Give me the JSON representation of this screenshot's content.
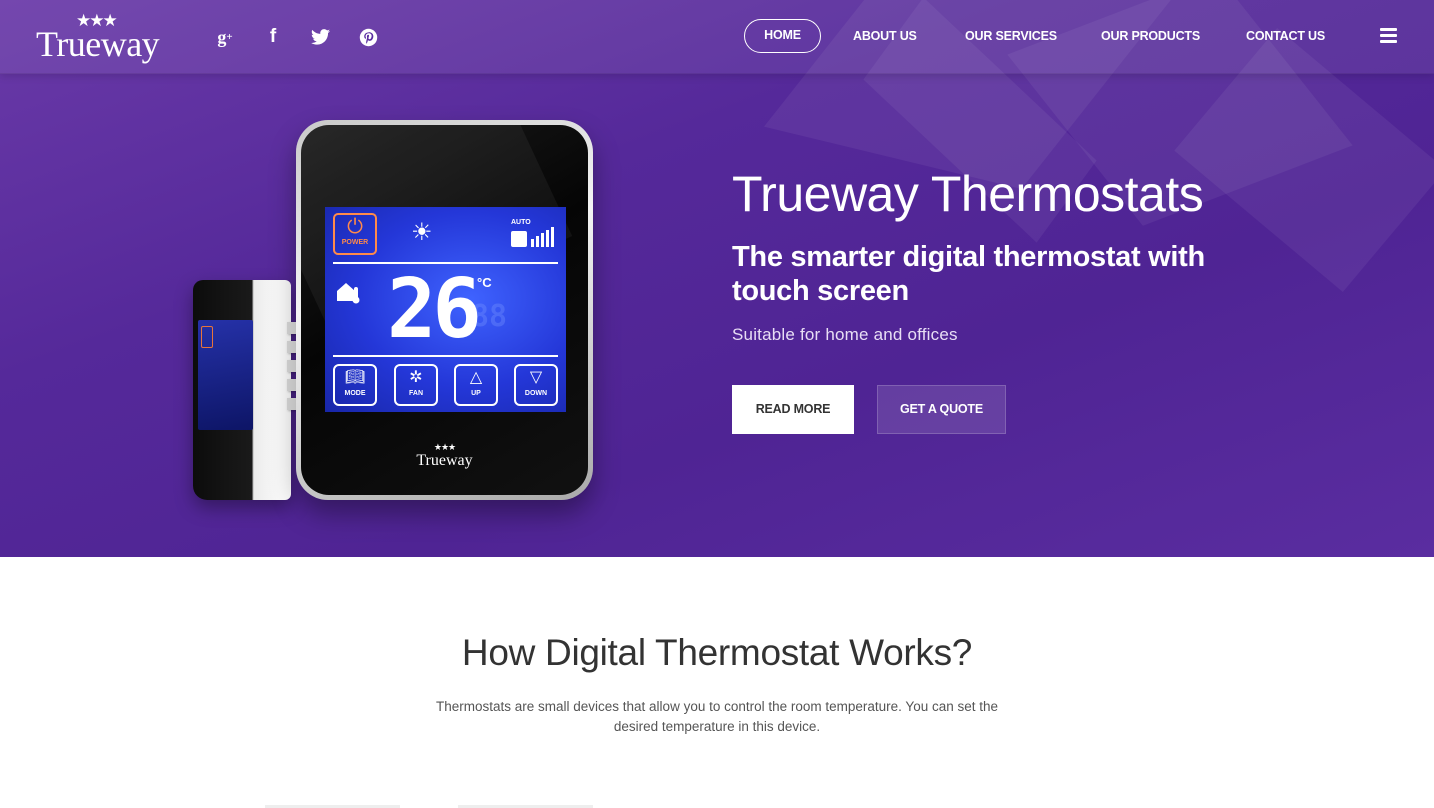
{
  "brand": {
    "name": "Trueway",
    "stars": "★★★"
  },
  "social": [
    {
      "name": "google-plus",
      "glyph": "g",
      "sup": "+"
    },
    {
      "name": "facebook",
      "glyph": "f"
    },
    {
      "name": "twitter"
    },
    {
      "name": "pinterest"
    }
  ],
  "nav": {
    "items": [
      {
        "label": "HOME",
        "active": true
      },
      {
        "label": "ABOUT US"
      },
      {
        "label": "OUR SERVICES"
      },
      {
        "label": "OUR PRODUCTS"
      },
      {
        "label": "CONTACT US"
      }
    ],
    "menu_icon": "hamburger-icon"
  },
  "hero": {
    "title": "Trueway Thermostats",
    "subtitle": "The smarter digital thermostat with touch screen",
    "tagline": "Suitable for home and offices",
    "buttons": {
      "read_more": "READ MORE",
      "get_quote": "GET A QUOTE"
    }
  },
  "device": {
    "power_label": "POWER",
    "auto_label": "AUTO",
    "temperature": "26",
    "unit": "°C",
    "keys": [
      "MODE",
      "FAN",
      "UP",
      "DOWN"
    ],
    "brand": "Trueway"
  },
  "section": {
    "title": "How Digital Thermostat Works?",
    "description": "Thermostats are small devices that allow you to control the room temperature. You can set the desired temperature in this device."
  },
  "colors": {
    "hero_bg": "#55299a",
    "lcd_blue": "#2437d8",
    "power_orange": "#ff8a4a",
    "text_dark": "#333333"
  }
}
